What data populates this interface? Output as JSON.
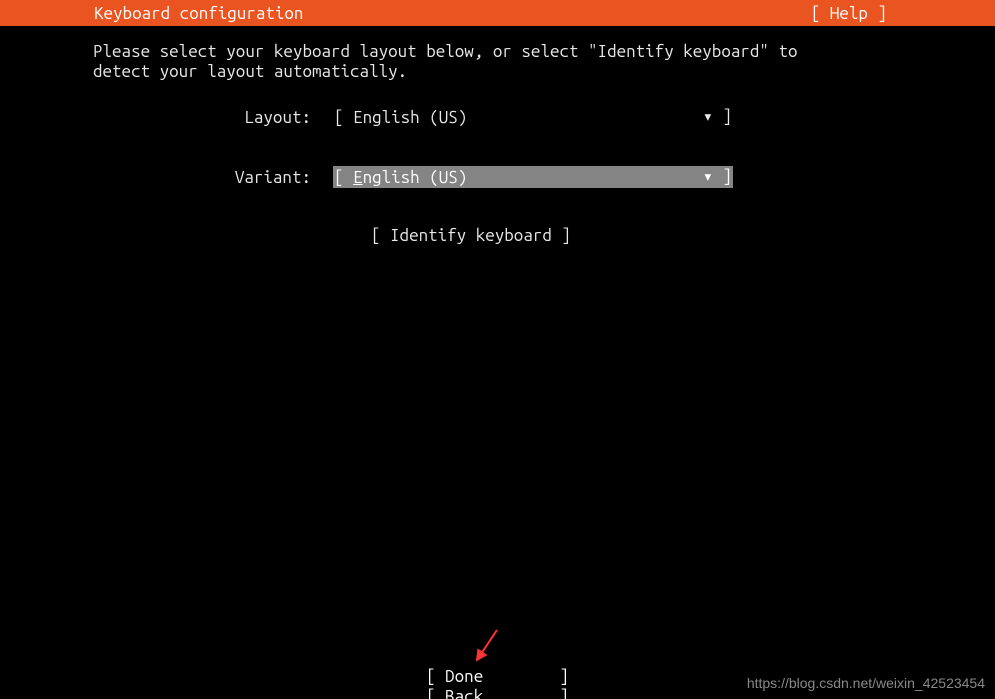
{
  "header": {
    "title": "Keyboard configuration",
    "help": "[ Help ]"
  },
  "instruction_line1": "Please select your keyboard layout below, or select \"Identify keyboard\" to",
  "instruction_line2": "detect your layout automatically.",
  "form": {
    "layout": {
      "label": "Layout:",
      "bracket_open": "[ ",
      "value": "English (US)",
      "arrow": "▾",
      "bracket_close": " ]"
    },
    "variant": {
      "label": "Variant:",
      "bracket_open": "[ ",
      "value_first": "E",
      "value_rest": "nglish (US)",
      "arrow": "▾",
      "bracket_close": " ]"
    }
  },
  "identify_button": "[ Identify keyboard ]",
  "footer": {
    "done": "[ Done        ]",
    "back": "[ Back        ]"
  },
  "watermark": "https://blog.csdn.net/weixin_42523454"
}
